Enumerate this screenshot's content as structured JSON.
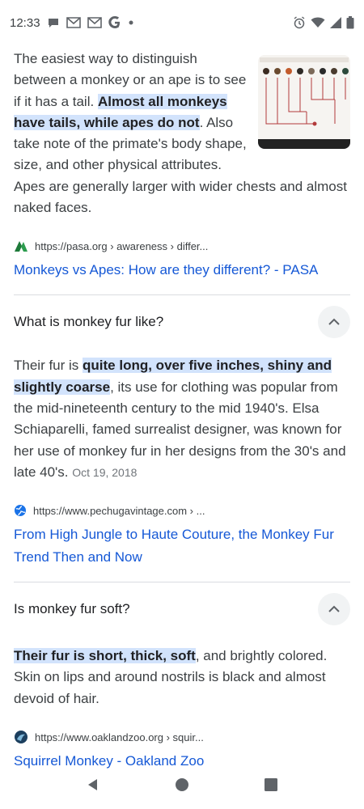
{
  "status_bar": {
    "time": "12:33",
    "notification_icons": [
      "chat-bubble-icon",
      "gmail-icon",
      "gmail-icon",
      "google-icon",
      "dot-icon"
    ],
    "system_icons": [
      "alarm-icon",
      "wifi-icon",
      "signal-icon",
      "battery-icon"
    ]
  },
  "answer1": {
    "text_before": "The easiest way to distinguish between a monkey or an ape is to see if it has a tail. ",
    "highlight": "Almost all monkeys have tails, while apes do not",
    "text_after": ". Also take note of the primate's body shape, size, and other physical attributes. Apes are generally larger with wider chests and almost naked faces.",
    "source_url": "https://pasa.org › awareness › differ...",
    "source_title": "Monkeys vs Apes: How are they different? - PASA"
  },
  "question2": {
    "question": "What is monkey fur like?",
    "text_before": "Their fur is ",
    "highlight": "quite long, over five inches, shiny and slightly coarse",
    "text_after": ", its use for clothing was popular from the mid-nineteenth century to the mid 1940's. Elsa Schiaparelli, famed surrealist designer, was known for her use of monkey fur in her designs from the 30's and late 40's. ",
    "date": "Oct 19, 2018",
    "source_url": "https://www.pechugavintage.com › ...",
    "source_title": "From High Jungle to Haute Couture, the Monkey Fur Trend Then and Now"
  },
  "question3": {
    "question": "Is monkey fur soft?",
    "highlight": "Their fur is short, thick, soft",
    "text_after": ", and brightly colored. Skin on lips and around nostrils is black and almost devoid of hair.",
    "source_url": "https://www.oaklandzoo.org › squir...",
    "source_title": "Squirrel Monkey - Oakland Zoo"
  },
  "nav": {
    "back": "back-icon",
    "home": "home-icon",
    "recents": "recents-icon"
  }
}
